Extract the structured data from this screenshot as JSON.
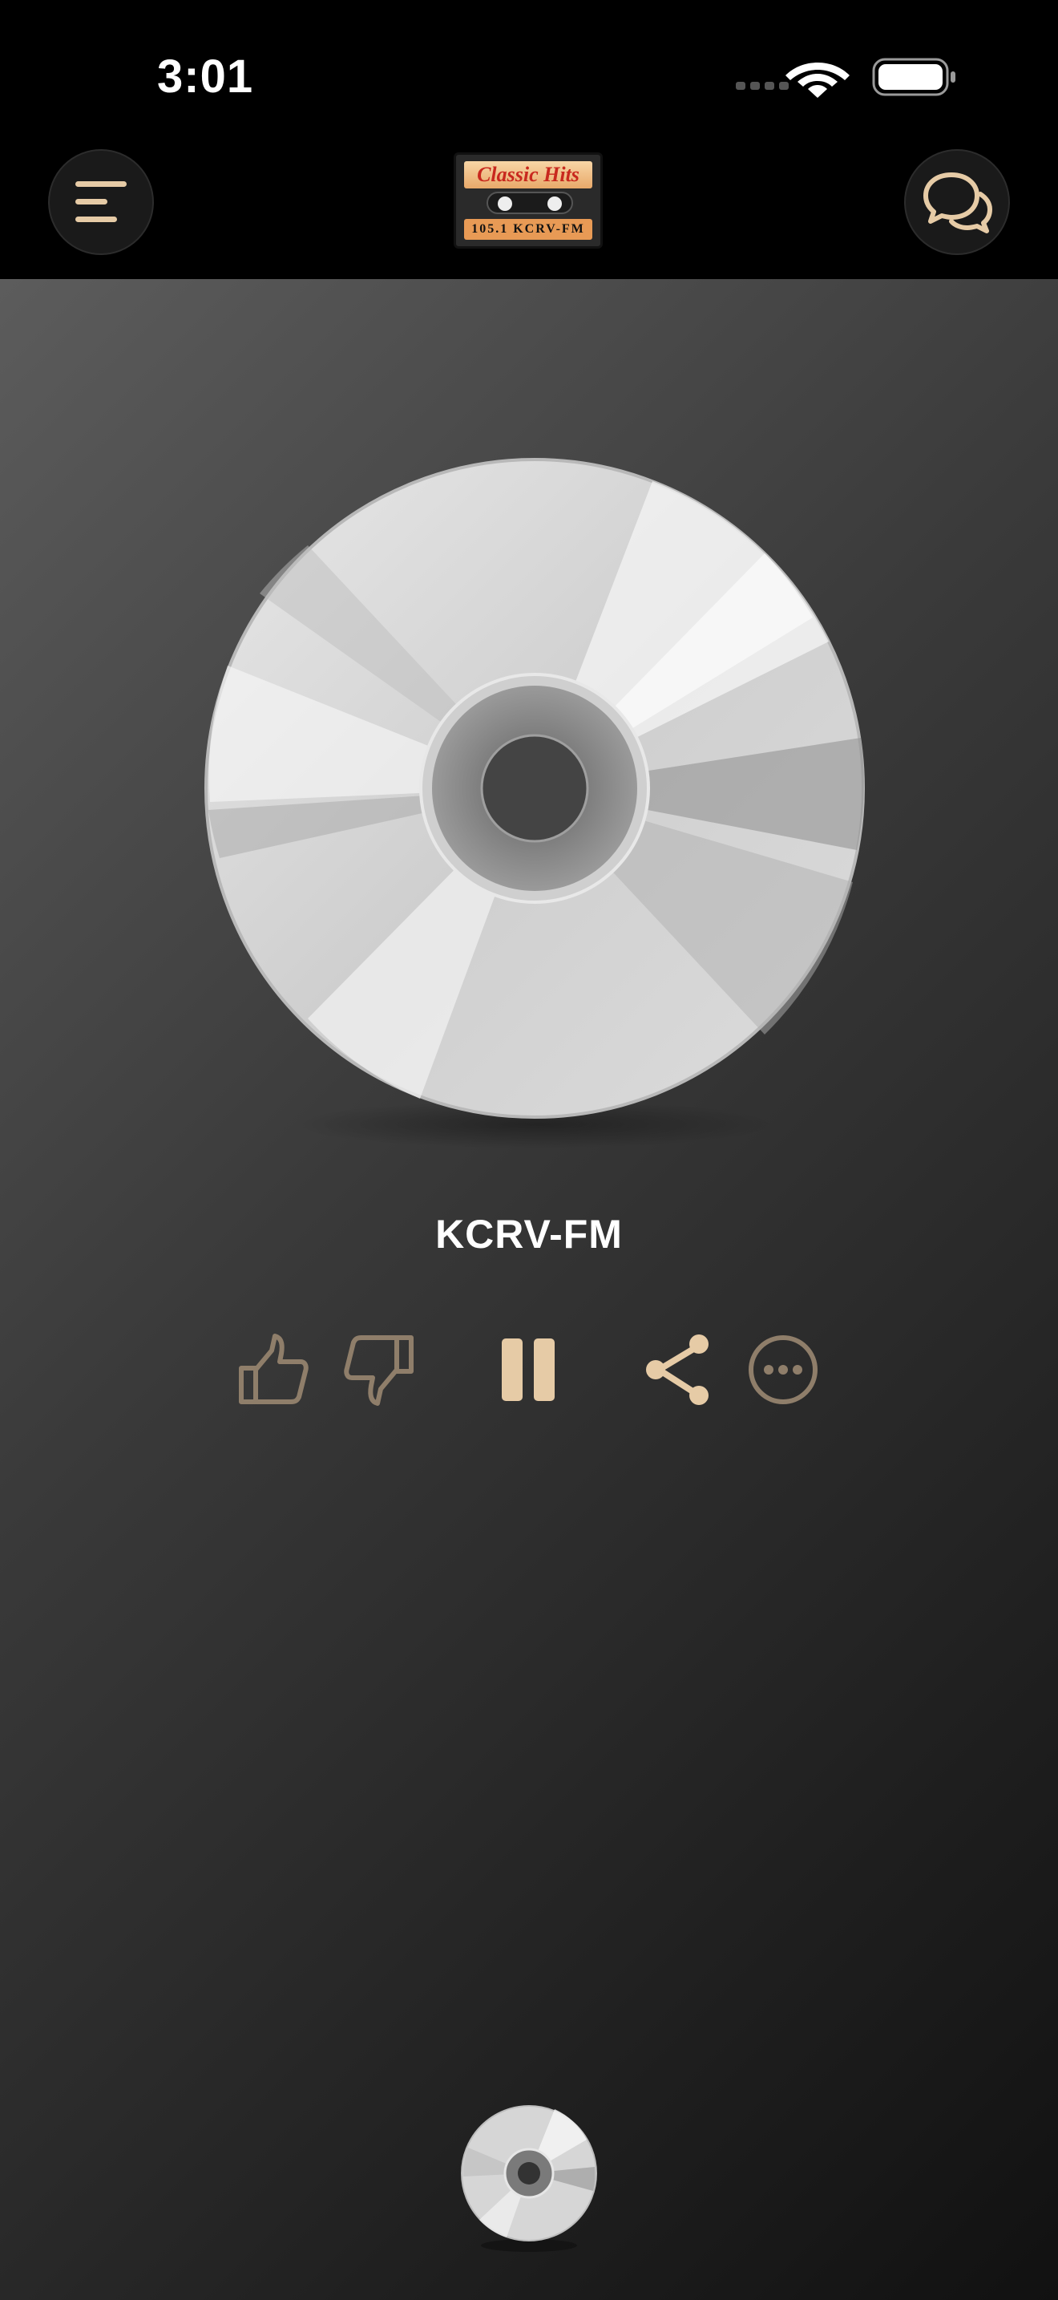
{
  "status_bar": {
    "time": "3:01",
    "icons": [
      "cellular-signal-icon",
      "wifi-icon",
      "battery-icon"
    ]
  },
  "header": {
    "menu_icon": "menu-icon",
    "chat_icon": "chat-bubbles-icon",
    "logo": {
      "top_text": "Classic Hits",
      "bottom_text": "105.1 KCRV-FM"
    }
  },
  "player": {
    "station_name": "KCRV-FM",
    "controls": [
      "thumbs-up-icon",
      "thumbs-down-icon",
      "pause-icon",
      "share-icon",
      "more-icon"
    ]
  },
  "colors": {
    "accent": "#e6cba6",
    "accent_dim": "#8f7e6a",
    "background_top": "#5c5c5c",
    "background_bottom": "#111111"
  }
}
